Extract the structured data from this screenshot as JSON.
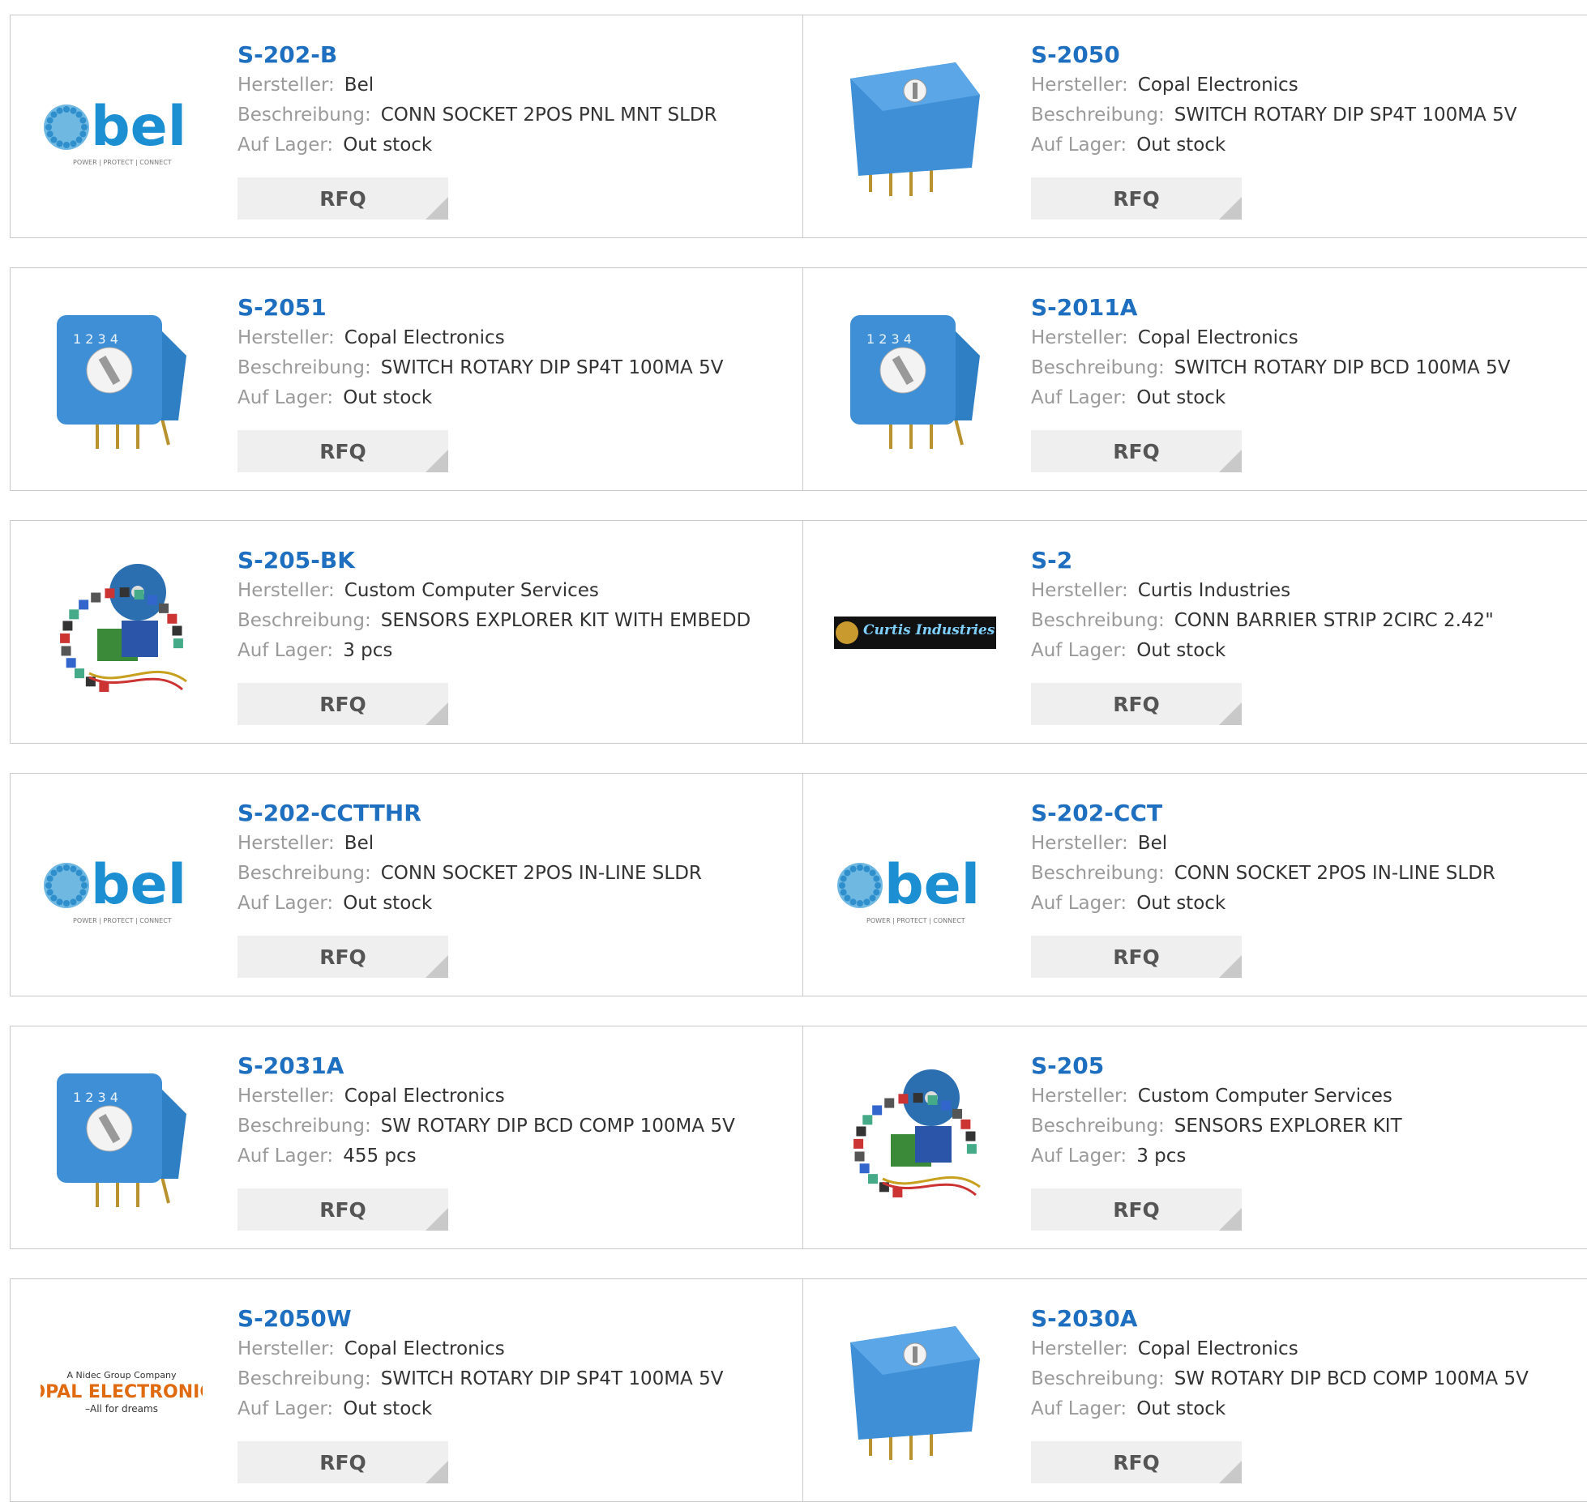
{
  "field_labels": {
    "manufacturer": "Hersteller:",
    "description": "Beschreibung:",
    "stock": "Auf Lager:"
  },
  "rfq_label": "RFQ",
  "products": [
    {
      "part": "S-202-B",
      "manufacturer": "Bel",
      "description": "CONN SOCKET 2POS PNL MNT SLDR",
      "stock": "Out stock",
      "image": "bel-logo"
    },
    {
      "part": "S-2050",
      "manufacturer": "Copal Electronics",
      "description": "SWITCH ROTARY DIP SP4T 100MA 5V",
      "stock": "Out stock",
      "image": "rotary-switch-top"
    },
    {
      "part": "S-2051",
      "manufacturer": "Copal Electronics",
      "description": "SWITCH ROTARY DIP SP4T 100MA 5V",
      "stock": "Out stock",
      "image": "rotary-switch-side"
    },
    {
      "part": "S-2011A",
      "manufacturer": "Copal Electronics",
      "description": "SWITCH ROTARY DIP BCD 100MA 5V",
      "stock": "Out stock",
      "image": "rotary-switch-side"
    },
    {
      "part": "S-205-BK",
      "manufacturer": "Custom Computer Services",
      "description": "SENSORS EXPLORER KIT WITH EMBEDD",
      "stock": "3 pcs",
      "image": "sensor-kit"
    },
    {
      "part": "S-2",
      "manufacturer": "Curtis Industries",
      "description": "CONN BARRIER STRIP 2CIRC 2.42\"",
      "stock": "Out stock",
      "image": "curtis-logo",
      "logo_text": "Curtis Industries"
    },
    {
      "part": "S-202-CCTTHR",
      "manufacturer": "Bel",
      "description": "CONN SOCKET 2POS IN-LINE SLDR",
      "stock": "Out stock",
      "image": "bel-logo"
    },
    {
      "part": "S-202-CCT",
      "manufacturer": "Bel",
      "description": "CONN SOCKET 2POS IN-LINE SLDR",
      "stock": "Out stock",
      "image": "bel-logo"
    },
    {
      "part": "S-2031A",
      "manufacturer": "Copal Electronics",
      "description": "SW ROTARY DIP BCD COMP 100MA 5V",
      "stock": "455 pcs",
      "image": "rotary-switch-side"
    },
    {
      "part": "S-205",
      "manufacturer": "Custom Computer Services",
      "description": "SENSORS EXPLORER KIT",
      "stock": "3 pcs",
      "image": "sensor-kit"
    },
    {
      "part": "S-2050W",
      "manufacturer": "Copal Electronics",
      "description": "SWITCH ROTARY DIP SP4T 100MA 5V",
      "stock": "Out stock",
      "image": "copal-logo",
      "logo_text": [
        "A Nidec Group Company",
        "COPAL ELECTRONICS",
        "–All for dreams"
      ]
    },
    {
      "part": "S-2030A",
      "manufacturer": "Copal Electronics",
      "description": "SW ROTARY DIP BCD COMP 100MA 5V",
      "stock": "Out stock",
      "image": "rotary-switch-top"
    }
  ],
  "colors": {
    "part_link": "#1e6fbf",
    "label": "#9a9a9a",
    "value": "#333333",
    "border": "#c9c9c9",
    "rfq_bg": "#efefef",
    "switch_blue": "#3f8fd6"
  }
}
